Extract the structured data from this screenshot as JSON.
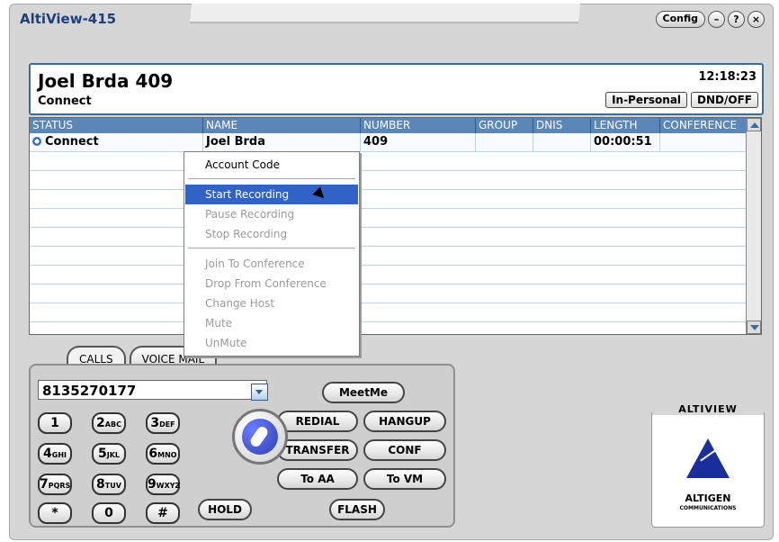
{
  "window": {
    "title": "AltiView-415",
    "buttons": {
      "config": "Config",
      "minimize": "–",
      "help": "?",
      "close": "×"
    }
  },
  "call_header": {
    "caller": "Joel Brda  409",
    "status": "Connect",
    "time": "12:18:23",
    "presence": "In-Personal",
    "dnd": "DND/OFF"
  },
  "grid": {
    "columns": [
      "STATUS",
      "NAME",
      "NUMBER",
      "GROUP",
      "DNIS",
      "LENGTH",
      "CONFERENCE"
    ],
    "rows": [
      {
        "status": "Connect",
        "name": "Joel Brda",
        "number": "409",
        "group": "",
        "dnis": "",
        "length": "00:00:51",
        "conference": ""
      }
    ]
  },
  "context_menu": {
    "items": [
      {
        "label": "Account Code",
        "state": "enabled"
      },
      {
        "label": "Start Recording",
        "state": "highlighted"
      },
      {
        "label": "Pause Recording",
        "state": "disabled"
      },
      {
        "label": "Stop  Recording",
        "state": "disabled"
      },
      {
        "label": "Join To Conference",
        "state": "disabled"
      },
      {
        "label": "Drop From Conference",
        "state": "disabled"
      },
      {
        "label": "Change Host",
        "state": "disabled"
      },
      {
        "label": "Mute",
        "state": "disabled"
      },
      {
        "label": "UnMute",
        "state": "disabled"
      }
    ]
  },
  "tabs": {
    "calls": "CALLS",
    "voice_mail": "VOICE MAIL"
  },
  "dialer": {
    "number": "8135270177",
    "buttons": {
      "meetme": "MeetMe",
      "redial": "REDIAL",
      "hangup": "HANGUP",
      "transfer": "TRANSFER",
      "conf": "CONF",
      "to_aa": "To AA",
      "to_vm": "To VM",
      "hold": "HOLD",
      "flash": "FLASH"
    },
    "keys": [
      {
        "digit": "1",
        "letters": ""
      },
      {
        "digit": "2",
        "letters": "ABC"
      },
      {
        "digit": "3",
        "letters": "DEF"
      },
      {
        "digit": "4",
        "letters": "GHI"
      },
      {
        "digit": "5",
        "letters": "JKL"
      },
      {
        "digit": "6",
        "letters": "MNO"
      },
      {
        "digit": "7",
        "letters": "PQRS"
      },
      {
        "digit": "8",
        "letters": "TUV"
      },
      {
        "digit": "9",
        "letters": "WXYZ"
      },
      {
        "digit": "*",
        "letters": ""
      },
      {
        "digit": "0",
        "letters": ""
      },
      {
        "digit": "#",
        "letters": ""
      }
    ]
  },
  "brand": {
    "title": "ALTIVIEW",
    "name": "ALTIGEN",
    "subtitle": "COMMUNICATIONS"
  },
  "colors": {
    "header_blue": "#5a86b8",
    "menu_highlight": "#3163c6",
    "logo_blue": "#1a2f9b"
  }
}
